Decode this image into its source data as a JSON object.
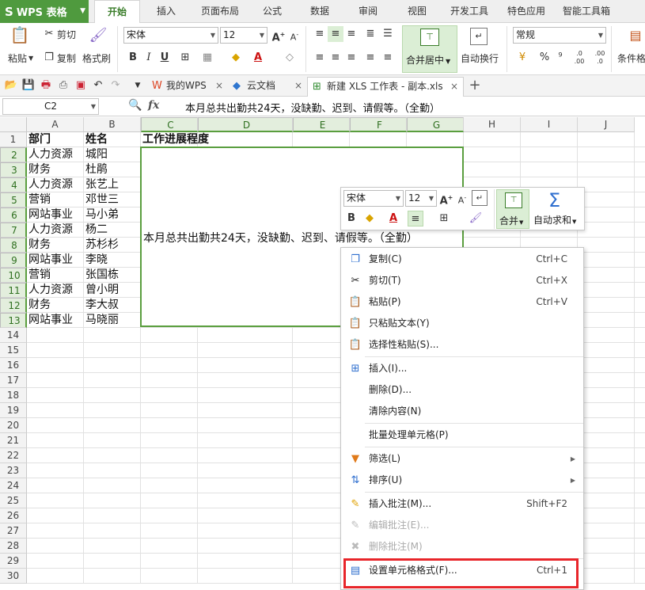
{
  "app": {
    "name": "WPS 表格",
    "accent": "#4f9a3e"
  },
  "menu": {
    "tabs": [
      "开始",
      "插入",
      "页面布局",
      "公式",
      "数据",
      "审阅",
      "视图",
      "开发工具",
      "特色应用",
      "智能工具箱"
    ]
  },
  "ribbon": {
    "cut": "剪切",
    "paste": "粘贴",
    "copy": "复制",
    "format_painter": "格式刷",
    "font_name": "宋体",
    "font_size": "12",
    "merge_center": "合并居中",
    "wrap_text": "自动换行",
    "number_format": "常规",
    "conditional_format": "条件格",
    "bold": "B",
    "italic": "I",
    "underline": "U",
    "percent": "%",
    "thousands": "⁹"
  },
  "tabstrip": {
    "tabs": [
      {
        "label": "我的WPS",
        "active": false
      },
      {
        "label": "云文档",
        "active": false
      },
      {
        "label": "新建 XLS 工作表 - 副本.xls",
        "active": true
      }
    ]
  },
  "formula_bar": {
    "cell_ref": "C2",
    "fx": "fx",
    "value": "本月总共出勤共24天，没缺勤、迟到、请假等。（全勤）"
  },
  "sheet": {
    "columns": [
      "A",
      "B",
      "C",
      "D",
      "E",
      "F",
      "G",
      "H",
      "I",
      "J"
    ],
    "rows": [
      "1",
      "2",
      "3",
      "4",
      "5",
      "6",
      "7",
      "8",
      "9",
      "10",
      "11",
      "12",
      "13",
      "14",
      "15",
      "16",
      "17",
      "18",
      "19",
      "20",
      "21",
      "22",
      "23",
      "24",
      "25",
      "26",
      "27",
      "28",
      "29",
      "30"
    ],
    "header": {
      "dept": "部门",
      "name": "姓名",
      "progress": "工作进展程度"
    },
    "data": [
      [
        "人力资源",
        "城阳"
      ],
      [
        "财务",
        "杜鹃"
      ],
      [
        "人力资源",
        "张艺上"
      ],
      [
        "营销",
        "邓世三"
      ],
      [
        "网站事业",
        "马小弟"
      ],
      [
        "人力资源",
        "杨二"
      ],
      [
        "财务",
        "苏杉杉"
      ],
      [
        "网站事业",
        "李晓"
      ],
      [
        "营销",
        "张国栋"
      ],
      [
        "人力资源",
        "曾小明"
      ],
      [
        "财务",
        "李大叔"
      ],
      [
        "网站事业",
        "马晓丽"
      ]
    ],
    "merged_text": "本月总共出勤共24天，没缺勤、迟到、请假等。（全勤）"
  },
  "mini_toolbar": {
    "font_name": "宋体",
    "font_size": "12",
    "merge": "合并",
    "autosum": "自动求和",
    "bold": "B"
  },
  "context_menu": {
    "items": [
      {
        "label": "复制(C)",
        "key": "Ctrl+C",
        "icon": "copy-icon",
        "disabled": false
      },
      {
        "label": "剪切(T)",
        "key": "Ctrl+X",
        "icon": "scissors-icon",
        "disabled": false
      },
      {
        "label": "粘贴(P)",
        "key": "Ctrl+V",
        "icon": "paste-icon",
        "disabled": false
      },
      {
        "label": "只粘贴文本(Y)",
        "key": "",
        "icon": "paste-text-icon",
        "disabled": false
      },
      {
        "label": "选择性粘贴(S)...",
        "key": "",
        "icon": "paste-special-icon",
        "disabled": false
      },
      {
        "label": "插入(I)...",
        "key": "",
        "icon": "insert-icon",
        "disabled": false
      },
      {
        "label": "删除(D)...",
        "key": "",
        "icon": "",
        "disabled": false
      },
      {
        "label": "清除内容(N)",
        "key": "",
        "icon": "",
        "disabled": false
      },
      {
        "label": "批量处理单元格(P)",
        "key": "",
        "icon": "",
        "disabled": false
      },
      {
        "label": "筛选(L)",
        "key": "",
        "icon": "filter-icon",
        "disabled": false,
        "submenu": true
      },
      {
        "label": "排序(U)",
        "key": "",
        "icon": "sort-icon",
        "disabled": false,
        "submenu": true
      },
      {
        "label": "插入批注(M)...",
        "key": "Shift+F2",
        "icon": "comment-icon",
        "disabled": false
      },
      {
        "label": "编辑批注(E)...",
        "key": "",
        "icon": "edit-comment-icon",
        "disabled": true
      },
      {
        "label": "删除批注(M)",
        "key": "",
        "icon": "delete-comment-icon",
        "disabled": true
      },
      {
        "label": "设置单元格格式(F)...",
        "key": "Ctrl+1",
        "icon": "format-cells-icon",
        "disabled": false
      }
    ],
    "highlight_color": "#e8252a"
  }
}
